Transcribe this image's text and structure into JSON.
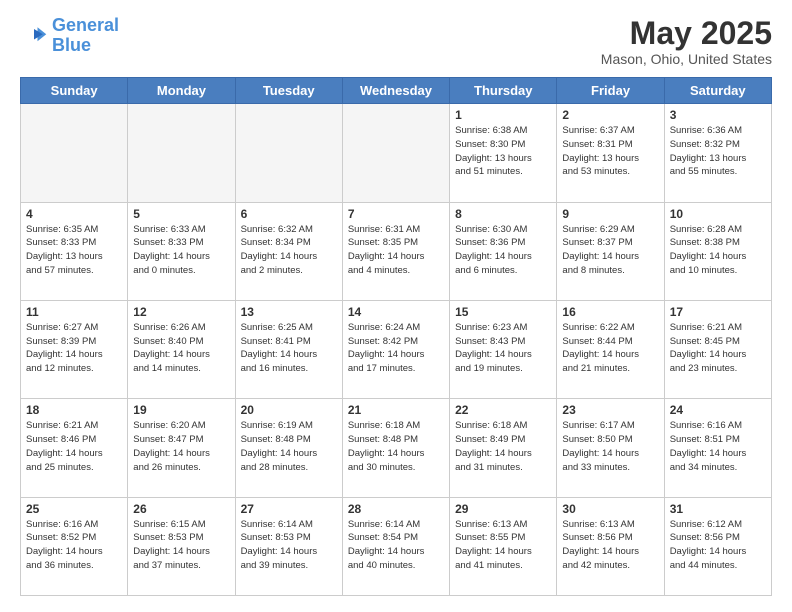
{
  "header": {
    "logo_line1": "General",
    "logo_line2": "Blue",
    "month": "May 2025",
    "location": "Mason, Ohio, United States"
  },
  "weekdays": [
    "Sunday",
    "Monday",
    "Tuesday",
    "Wednesday",
    "Thursday",
    "Friday",
    "Saturday"
  ],
  "weeks": [
    [
      {
        "day": "",
        "info": ""
      },
      {
        "day": "",
        "info": ""
      },
      {
        "day": "",
        "info": ""
      },
      {
        "day": "",
        "info": ""
      },
      {
        "day": "1",
        "info": "Sunrise: 6:38 AM\nSunset: 8:30 PM\nDaylight: 13 hours\nand 51 minutes."
      },
      {
        "day": "2",
        "info": "Sunrise: 6:37 AM\nSunset: 8:31 PM\nDaylight: 13 hours\nand 53 minutes."
      },
      {
        "day": "3",
        "info": "Sunrise: 6:36 AM\nSunset: 8:32 PM\nDaylight: 13 hours\nand 55 minutes."
      }
    ],
    [
      {
        "day": "4",
        "info": "Sunrise: 6:35 AM\nSunset: 8:33 PM\nDaylight: 13 hours\nand 57 minutes."
      },
      {
        "day": "5",
        "info": "Sunrise: 6:33 AM\nSunset: 8:33 PM\nDaylight: 14 hours\nand 0 minutes."
      },
      {
        "day": "6",
        "info": "Sunrise: 6:32 AM\nSunset: 8:34 PM\nDaylight: 14 hours\nand 2 minutes."
      },
      {
        "day": "7",
        "info": "Sunrise: 6:31 AM\nSunset: 8:35 PM\nDaylight: 14 hours\nand 4 minutes."
      },
      {
        "day": "8",
        "info": "Sunrise: 6:30 AM\nSunset: 8:36 PM\nDaylight: 14 hours\nand 6 minutes."
      },
      {
        "day": "9",
        "info": "Sunrise: 6:29 AM\nSunset: 8:37 PM\nDaylight: 14 hours\nand 8 minutes."
      },
      {
        "day": "10",
        "info": "Sunrise: 6:28 AM\nSunset: 8:38 PM\nDaylight: 14 hours\nand 10 minutes."
      }
    ],
    [
      {
        "day": "11",
        "info": "Sunrise: 6:27 AM\nSunset: 8:39 PM\nDaylight: 14 hours\nand 12 minutes."
      },
      {
        "day": "12",
        "info": "Sunrise: 6:26 AM\nSunset: 8:40 PM\nDaylight: 14 hours\nand 14 minutes."
      },
      {
        "day": "13",
        "info": "Sunrise: 6:25 AM\nSunset: 8:41 PM\nDaylight: 14 hours\nand 16 minutes."
      },
      {
        "day": "14",
        "info": "Sunrise: 6:24 AM\nSunset: 8:42 PM\nDaylight: 14 hours\nand 17 minutes."
      },
      {
        "day": "15",
        "info": "Sunrise: 6:23 AM\nSunset: 8:43 PM\nDaylight: 14 hours\nand 19 minutes."
      },
      {
        "day": "16",
        "info": "Sunrise: 6:22 AM\nSunset: 8:44 PM\nDaylight: 14 hours\nand 21 minutes."
      },
      {
        "day": "17",
        "info": "Sunrise: 6:21 AM\nSunset: 8:45 PM\nDaylight: 14 hours\nand 23 minutes."
      }
    ],
    [
      {
        "day": "18",
        "info": "Sunrise: 6:21 AM\nSunset: 8:46 PM\nDaylight: 14 hours\nand 25 minutes."
      },
      {
        "day": "19",
        "info": "Sunrise: 6:20 AM\nSunset: 8:47 PM\nDaylight: 14 hours\nand 26 minutes."
      },
      {
        "day": "20",
        "info": "Sunrise: 6:19 AM\nSunset: 8:48 PM\nDaylight: 14 hours\nand 28 minutes."
      },
      {
        "day": "21",
        "info": "Sunrise: 6:18 AM\nSunset: 8:48 PM\nDaylight: 14 hours\nand 30 minutes."
      },
      {
        "day": "22",
        "info": "Sunrise: 6:18 AM\nSunset: 8:49 PM\nDaylight: 14 hours\nand 31 minutes."
      },
      {
        "day": "23",
        "info": "Sunrise: 6:17 AM\nSunset: 8:50 PM\nDaylight: 14 hours\nand 33 minutes."
      },
      {
        "day": "24",
        "info": "Sunrise: 6:16 AM\nSunset: 8:51 PM\nDaylight: 14 hours\nand 34 minutes."
      }
    ],
    [
      {
        "day": "25",
        "info": "Sunrise: 6:16 AM\nSunset: 8:52 PM\nDaylight: 14 hours\nand 36 minutes."
      },
      {
        "day": "26",
        "info": "Sunrise: 6:15 AM\nSunset: 8:53 PM\nDaylight: 14 hours\nand 37 minutes."
      },
      {
        "day": "27",
        "info": "Sunrise: 6:14 AM\nSunset: 8:53 PM\nDaylight: 14 hours\nand 39 minutes."
      },
      {
        "day": "28",
        "info": "Sunrise: 6:14 AM\nSunset: 8:54 PM\nDaylight: 14 hours\nand 40 minutes."
      },
      {
        "day": "29",
        "info": "Sunrise: 6:13 AM\nSunset: 8:55 PM\nDaylight: 14 hours\nand 41 minutes."
      },
      {
        "day": "30",
        "info": "Sunrise: 6:13 AM\nSunset: 8:56 PM\nDaylight: 14 hours\nand 42 minutes."
      },
      {
        "day": "31",
        "info": "Sunrise: 6:12 AM\nSunset: 8:56 PM\nDaylight: 14 hours\nand 44 minutes."
      }
    ]
  ]
}
